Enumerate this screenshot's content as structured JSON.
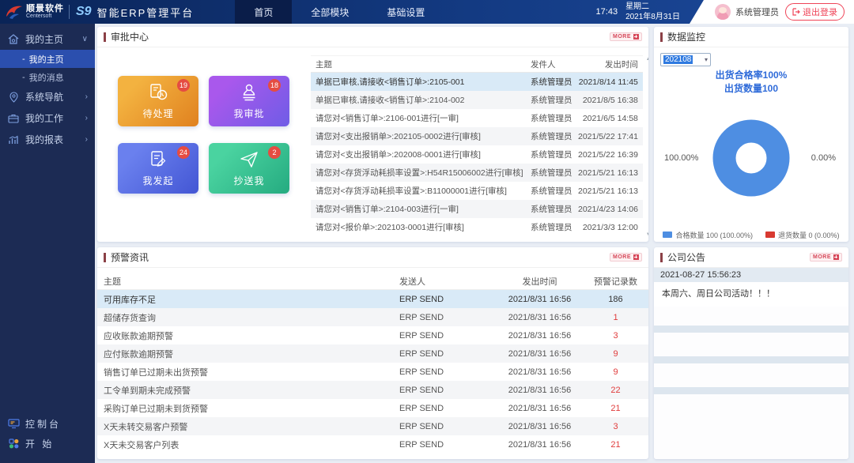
{
  "icons": {
    "chevron_down": "∨",
    "chevron_right": "›",
    "select_caret": "▾",
    "scroll_up": "▲",
    "scroll_down": "▼",
    "sub_bullet": "-"
  },
  "colors": {
    "header_blue": "#133a82",
    "sidebar_navy": "#1c2b54",
    "accent_red": "#d6485a",
    "selected_row_blue": "#d9eaf7",
    "donut_blue": "#4e8ee2",
    "legend_red": "#d83a31"
  },
  "header": {
    "logo_cn": "顺景软件",
    "logo_en": "Centersoft",
    "logo_s9": "S9",
    "platform_title": "智能ERP管理平台",
    "nav": [
      {
        "label": "首页",
        "active": true
      },
      {
        "label": "全部模块",
        "active": false
      },
      {
        "label": "基础设置",
        "active": false
      }
    ],
    "time": "17:43",
    "weekday": "星期二",
    "date": "2021年8月31日",
    "username": "系统管理员",
    "logout_label": "退出登录"
  },
  "sidebar": {
    "items": [
      {
        "label": "我的主页",
        "icon": "home-icon",
        "expanded": true,
        "children": [
          {
            "label": "我的主页",
            "active": true
          },
          {
            "label": "我的消息",
            "active": false
          }
        ]
      },
      {
        "label": "系统导航",
        "icon": "map-pin-icon"
      },
      {
        "label": "我的工作",
        "icon": "briefcase-icon"
      },
      {
        "label": "我的报表",
        "icon": "report-chart-icon"
      }
    ],
    "footer": [
      {
        "label": "控制台",
        "icon": "console-icon"
      },
      {
        "label": "开 始",
        "icon": "start-grid-icon"
      }
    ]
  },
  "approval_center": {
    "title": "审批中心",
    "more_label": "MORE",
    "tiles": [
      {
        "label": "待处理",
        "count": 19,
        "icon": "document-clock-icon",
        "color_from": "#f3b240",
        "color_to": "#e0811f"
      },
      {
        "label": "我审批",
        "count": 18,
        "icon": "stamp-icon",
        "color_from": "#a958ec",
        "color_to": "#6f5ce6"
      },
      {
        "label": "我发起",
        "count": 24,
        "icon": "document-edit-icon",
        "color_from": "#6a80ee",
        "color_to": "#4356d4"
      },
      {
        "label": "抄送我",
        "count": 2,
        "icon": "paper-plane-icon",
        "color_from": "#4ad3a0",
        "color_to": "#25ab80"
      }
    ],
    "table": {
      "columns": [
        "主题",
        "发件人",
        "发出时间"
      ],
      "rows": [
        [
          "单据已审核,请接收<销售订单>:2105-001",
          "系统管理员",
          "2021/8/14 11:45"
        ],
        [
          "单据已审核,请接收<销售订单>:2104-002",
          "系统管理员",
          "2021/8/5 16:38"
        ],
        [
          "请您对<销售订单>:2106-001进行[一审]",
          "系统管理员",
          "2021/6/5 14:58"
        ],
        [
          "请您对<支出报销单>:202105-0002进行[审核]",
          "系统管理员",
          "2021/5/22 17:41"
        ],
        [
          "请您对<支出报销单>:202008-0001进行[审核]",
          "系统管理员",
          "2021/5/22 16:39"
        ],
        [
          "请您对<存货浮动耗损率设置>:H54R15006002进行[审核]",
          "系统管理员",
          "2021/5/21 16:13"
        ],
        [
          "请您对<存货浮动耗损率设置>:B11000001进行[审核]",
          "系统管理员",
          "2021/5/21 16:13"
        ],
        [
          "请您对<销售订单>:2104-003进行[一审]",
          "系统管理员",
          "2021/4/23 14:06"
        ],
        [
          "请您对<报价单>:202103-0001进行[审核]",
          "系统管理员",
          "2021/3/3 12:00"
        ]
      ]
    }
  },
  "data_monitor": {
    "title": "数据监控",
    "period_select": "202108",
    "chart_title_line1": "出货合格率100%",
    "chart_title_line2": "出货数量100",
    "left_label": "100.00%",
    "right_label": "0.00%",
    "legend": [
      {
        "label": "合格数量 100 (100.00%)",
        "color": "#4e8ee2"
      },
      {
        "label": "退货数量 0 (0.00%)",
        "color": "#d83a31"
      }
    ]
  },
  "chart_data": {
    "type": "pie",
    "title": "出货合格率100% 出货数量100",
    "series": [
      {
        "name": "合格数量",
        "value": 100,
        "percent": "100.00%",
        "color": "#4e8ee2"
      },
      {
        "name": "退货数量",
        "value": 0,
        "percent": "0.00%",
        "color": "#d83a31"
      }
    ],
    "donut": true,
    "legend_position": "bottom"
  },
  "alerts": {
    "title": "预警资讯",
    "more_label": "MORE",
    "columns": [
      "主题",
      "发送人",
      "发出时间",
      "预警记录数"
    ],
    "rows": [
      {
        "subject": "可用库存不足",
        "sender": "ERP SEND",
        "time": "2021/8/31 16:56",
        "count": "186",
        "red": false
      },
      {
        "subject": "超储存货查询",
        "sender": "ERP SEND",
        "time": "2021/8/31 16:56",
        "count": "1",
        "red": true
      },
      {
        "subject": "应收账款逾期预警",
        "sender": "ERP SEND",
        "time": "2021/8/31 16:56",
        "count": "3",
        "red": true
      },
      {
        "subject": "应付账款逾期预警",
        "sender": "ERP SEND",
        "time": "2021/8/31 16:56",
        "count": "9",
        "red": true
      },
      {
        "subject": "销售订单已过期未出货预警",
        "sender": "ERP SEND",
        "time": "2021/8/31 16:56",
        "count": "9",
        "red": true
      },
      {
        "subject": "工令单到期未完成预警",
        "sender": "ERP SEND",
        "time": "2021/8/31 16:56",
        "count": "22",
        "red": true
      },
      {
        "subject": "采购订单已过期未到货预警",
        "sender": "ERP SEND",
        "time": "2021/8/31 16:56",
        "count": "21",
        "red": true
      },
      {
        "subject": "X天未转交易客户预警",
        "sender": "ERP SEND",
        "time": "2021/8/31 16:56",
        "count": "3",
        "red": true
      },
      {
        "subject": "X天未交易客户列表",
        "sender": "ERP SEND",
        "time": "2021/8/31 16:56",
        "count": "21",
        "red": true
      }
    ]
  },
  "announcements": {
    "title": "公司公告",
    "more_label": "MORE",
    "entries": [
      {
        "time": "2021-08-27 15:56:23",
        "text": "本周六、周日公司活动！！！"
      }
    ]
  }
}
